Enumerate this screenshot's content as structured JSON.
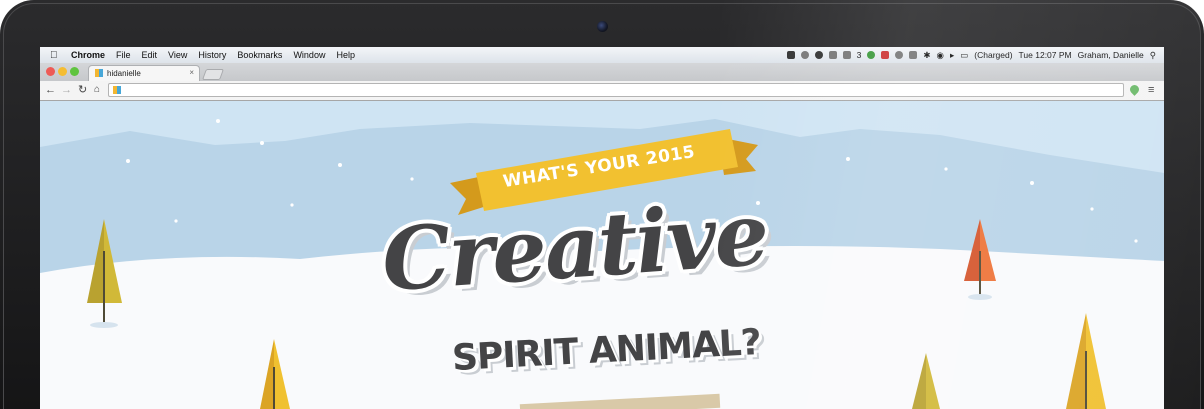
{
  "menubar": {
    "app": "Chrome",
    "items": [
      "File",
      "Edit",
      "View",
      "History",
      "Bookmarks",
      "Window",
      "Help"
    ],
    "badge_count": "3",
    "battery": "(Charged)",
    "clock": "Tue 12:07 PM",
    "user": "Graham, Danielle",
    "status_icons": [
      "evernote-icon",
      "bell-icon",
      "speech-icon",
      "dropbox-icon",
      "drive-icon",
      "adobe-icon",
      "sync-icon",
      "shield-icon",
      "clock-icon",
      "screen-icon",
      "bluetooth-icon",
      "wifi-icon",
      "volume-icon",
      "battery-icon",
      "search-icon"
    ]
  },
  "browser": {
    "tab_title": "hidanielle",
    "url": ""
  },
  "hero": {
    "banner": "WHAT'S YOUR 2015",
    "headline": "Creative",
    "subhead": "SPIRIT ANIMAL?"
  },
  "colors": {
    "sky": "#cfe4f3",
    "mountains": "#b9d4e8",
    "banner": "#f2c130",
    "headline": "#444446",
    "tree_yellow": "#e8b629",
    "tree_olive": "#b9a230",
    "tree_orange": "#e8622c"
  }
}
